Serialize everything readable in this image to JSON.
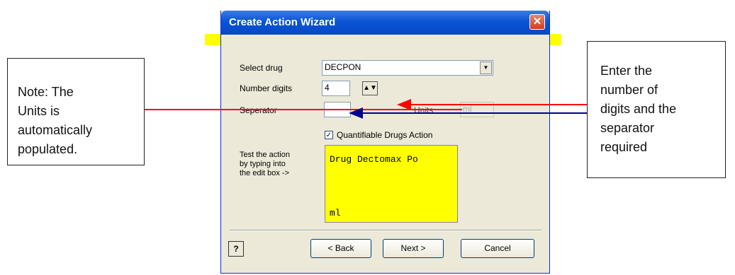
{
  "dialog": {
    "title": "Create Action Wizard",
    "close_glyph": "✕",
    "select_drug_label": "Select drug",
    "select_drug_value": "DECPON",
    "number_digits_label": "Number digits",
    "number_digits_value": "4",
    "separator_label": "Seperator",
    "separator_value": "",
    "units_label": "Units",
    "units_value": "ml",
    "quantifiable_label": "Quantifiable Drugs Action",
    "quantifiable_checked": true,
    "test_label": [
      "Test the action",
      "by typing into",
      "the edit box  ->"
    ],
    "test_box_line1": "Drug Dectomax Po",
    "test_box_line2": "ml",
    "help_glyph": "?",
    "back_button": "< Back",
    "next_button": "Next >",
    "cancel_button": "Cancel"
  },
  "callouts": {
    "left_note": [
      "Note:  The",
      "Units is",
      "automatically",
      "populated."
    ],
    "right_note": [
      "Enter the",
      "number of",
      "digits and the",
      "separator",
      "required"
    ]
  },
  "colors": {
    "highlight": "#ffff00",
    "red_arrow": "#ff0000",
    "blue_arrow": "#00008b",
    "title_bar": "#0a55d6"
  }
}
